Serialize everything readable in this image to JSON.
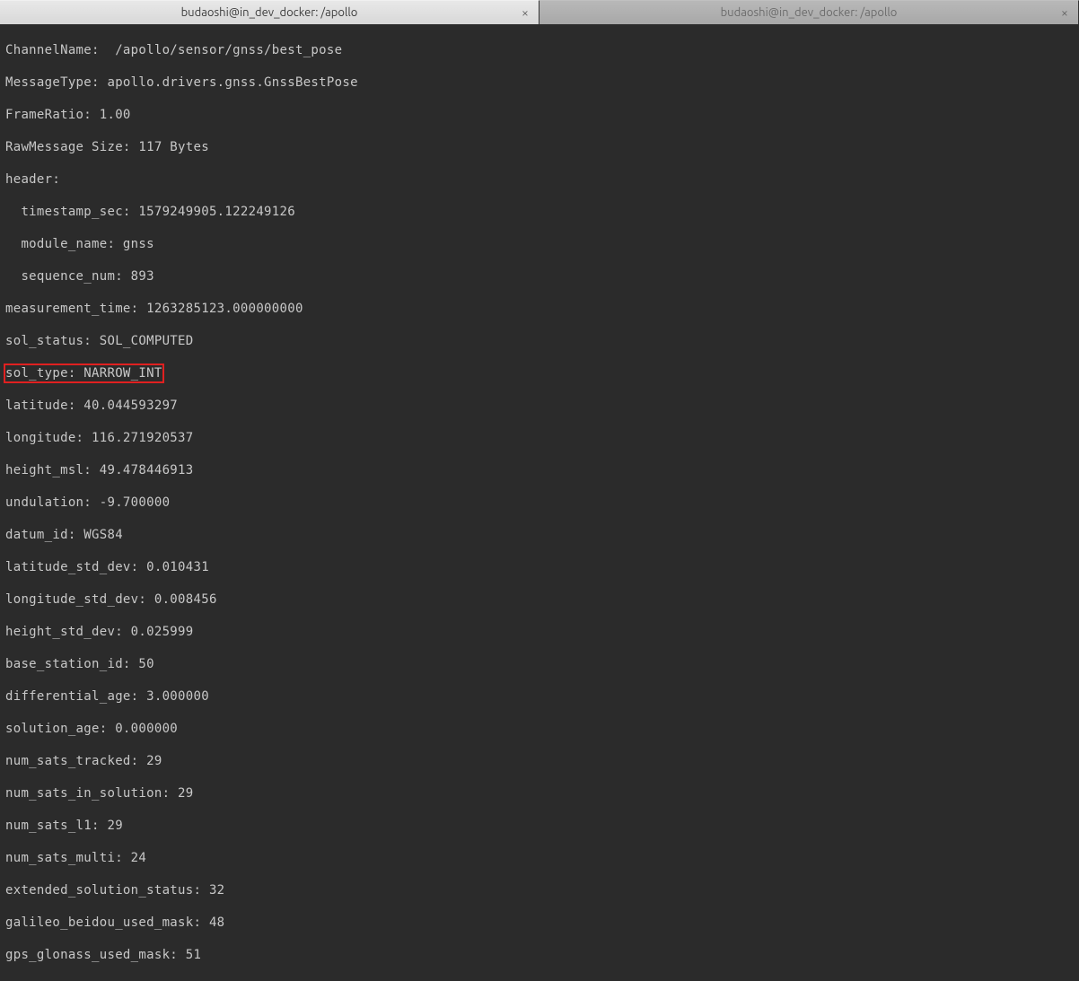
{
  "tabs": [
    {
      "title": "budaoshi@in_dev_docker: /apollo",
      "active": true
    },
    {
      "title": "budaoshi@in_dev_docker: /apollo",
      "active": false
    }
  ],
  "terminal": {
    "channel_name_label": "ChannelName:  /apollo/sensor/gnss/best_pose",
    "message_type_label": "MessageType: apollo.drivers.gnss.GnssBestPose",
    "frame_ratio_label": "FrameRatio: 1.00",
    "raw_message_size_label": "RawMessage Size: 117 Bytes",
    "header_label": "header:",
    "timestamp_sec_label": "  timestamp_sec: 1579249905.122249126",
    "module_name_label": "  module_name: gnss",
    "sequence_num_label": "  sequence_num: 893",
    "measurement_time_label": "measurement_time: 1263285123.000000000",
    "sol_status_label": "sol_status: SOL_COMPUTED",
    "sol_type_label": "sol_type: NARROW_INT",
    "latitude_label": "latitude: 40.044593297",
    "longitude_label": "longitude: 116.271920537",
    "height_msl_label": "height_msl: 49.478446913",
    "undulation_label": "undulation: -9.700000",
    "datum_id_label": "datum_id: WGS84",
    "latitude_std_dev_label": "latitude_std_dev: 0.010431",
    "longitude_std_dev_label": "longitude_std_dev: 0.008456",
    "height_std_dev_label": "height_std_dev: 0.025999",
    "base_station_id_label": "base_station_id: 50",
    "differential_age_label": "differential_age: 3.000000",
    "solution_age_label": "solution_age: 0.000000",
    "num_sats_tracked_label": "num_sats_tracked: 29",
    "num_sats_in_solution_label": "num_sats_in_solution: 29",
    "num_sats_l1_label": "num_sats_l1: 29",
    "num_sats_multi_label": "num_sats_multi: 24",
    "extended_solution_status_label": "extended_solution_status: 32",
    "galileo_beidou_used_mask_label": "galileo_beidou_used_mask: 48",
    "gps_glonass_used_mask_label": "gps_glonass_used_mask: 51"
  }
}
